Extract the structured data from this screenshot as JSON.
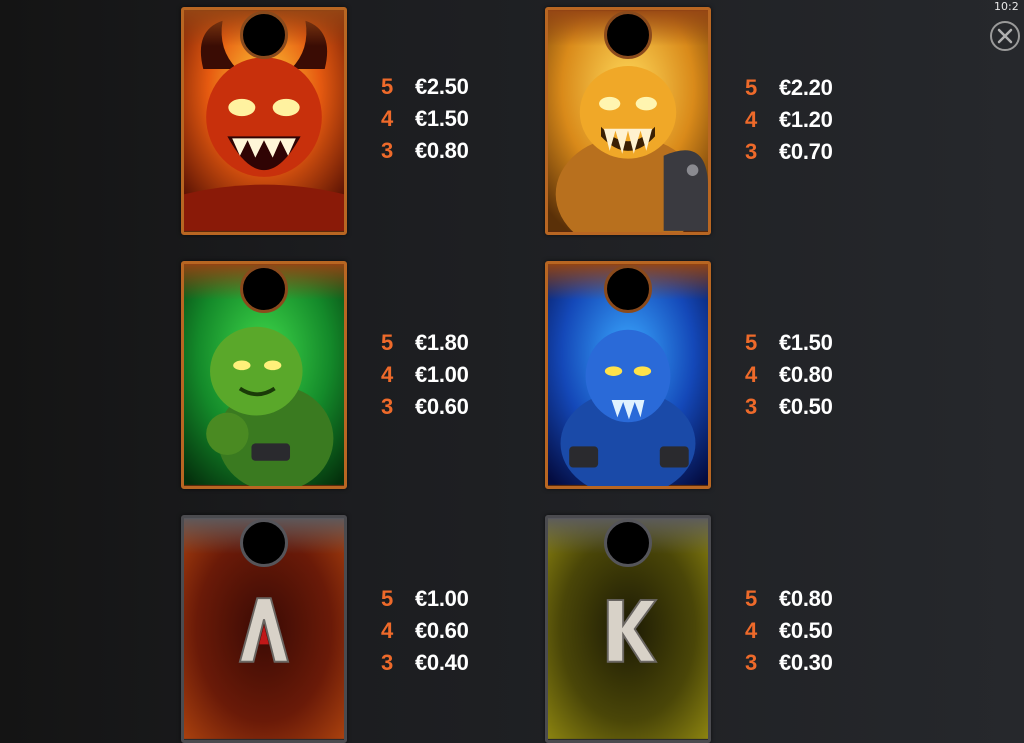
{
  "status": {
    "clock": "10:2"
  },
  "colors": {
    "count": "#ee6a2a",
    "value": "#ffffff",
    "gold_frame": "#b86622",
    "silver_frame": "#4b4b4f"
  },
  "symbols": [
    {
      "name": "red-demon",
      "icon": "red-demon-icon",
      "pays": [
        {
          "count": "5",
          "value": "€2.50"
        },
        {
          "count": "4",
          "value": "€1.50"
        },
        {
          "count": "3",
          "value": "€0.80"
        }
      ]
    },
    {
      "name": "yellow-demon",
      "icon": "yellow-demon-icon",
      "pays": [
        {
          "count": "5",
          "value": "€2.20"
        },
        {
          "count": "4",
          "value": "€1.20"
        },
        {
          "count": "3",
          "value": "€0.70"
        }
      ]
    },
    {
      "name": "green-goblin",
      "icon": "green-goblin-icon",
      "pays": [
        {
          "count": "5",
          "value": "€1.80"
        },
        {
          "count": "4",
          "value": "€1.00"
        },
        {
          "count": "3",
          "value": "€0.60"
        }
      ]
    },
    {
      "name": "blue-goblin",
      "icon": "blue-goblin-icon",
      "pays": [
        {
          "count": "5",
          "value": "€1.50"
        },
        {
          "count": "4",
          "value": "€0.80"
        },
        {
          "count": "3",
          "value": "€0.50"
        }
      ]
    },
    {
      "name": "letter-a",
      "icon": "letter-a-icon",
      "letter": "A",
      "pays": [
        {
          "count": "5",
          "value": "€1.00"
        },
        {
          "count": "4",
          "value": "€0.60"
        },
        {
          "count": "3",
          "value": "€0.40"
        }
      ]
    },
    {
      "name": "letter-k",
      "icon": "letter-k-icon",
      "letter": "K",
      "pays": [
        {
          "count": "5",
          "value": "€0.80"
        },
        {
          "count": "4",
          "value": "€0.50"
        },
        {
          "count": "3",
          "value": "€0.30"
        }
      ]
    }
  ]
}
